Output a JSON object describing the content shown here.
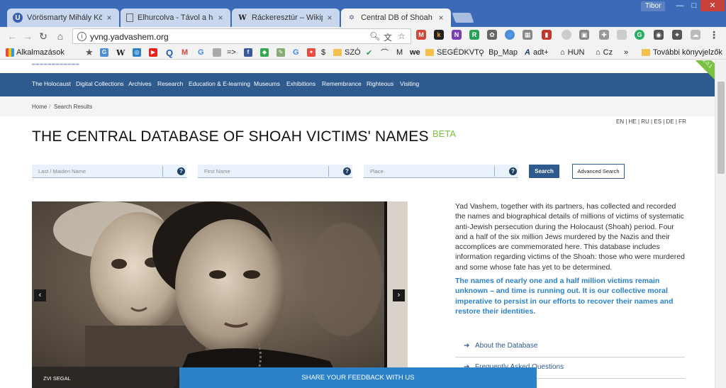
{
  "browser": {
    "tabs": [
      {
        "label": "Vörösmarty Mihály Köny",
        "icon": "library-icon"
      },
      {
        "label": "Elhurcolva - Távol a hazá",
        "icon": "page-icon"
      },
      {
        "label": "Ráckeresztúr – Wikipédia",
        "icon": "wikipedia-icon"
      },
      {
        "label": "Central DB of Shoah Victi",
        "icon": "yadvashem-icon"
      }
    ],
    "user": "Tibor",
    "url": "yvng.yadvashem.org",
    "bookmarks": {
      "apps": "Alkalmazások",
      "szo": "SZÓ",
      "m": "M",
      "segedkvt": "SEGÉDKVT",
      "bpmap": "Bp_Map",
      "adt": "adt+",
      "hun": "HUN",
      "cz": "Cz",
      "more": "»",
      "other": "További könyvjelzők",
      "arrow": "=>"
    }
  },
  "site": {
    "nav": [
      "The Holocaust",
      "Digital Collections",
      "Archives",
      "Research",
      "Education & E-learning",
      "Museums",
      "Exhibitions",
      "Remembrance",
      "Righteous",
      "Visiting"
    ],
    "version": "V.2.0.1",
    "breadcrumb": {
      "home": "Home",
      "sep": "/",
      "current": "Search Results"
    },
    "languages": "EN | HE | RU | ES | DE | FR",
    "title": "THE CENTRAL DATABASE OF SHOAH VICTIMS' NAMES",
    "beta": "BETA",
    "search": {
      "last_name_placeholder": "Last / Maiden Name",
      "first_name_placeholder": "First Name",
      "place_placeholder": "Place",
      "help": "?",
      "search_label": "Search",
      "advanced_label": "Advanced Search"
    },
    "photo": {
      "caption": "ZVI SEGAL",
      "prev": "‹",
      "next": "›"
    },
    "description": "Yad Vashem, together with its partners, has collected and recorded the names and biographical details of millions of victims of systematic anti-Jewish persecution during the Holocaust (Shoah) period. Four and a half of the six million Jews murdered by the Nazis and their accomplices are commemorated here. This database includes information regarding victims of the Shoah: those who were murdered and some whose fate has yet to be determined.",
    "emphasis": "The names of nearly one and a half million victims remain unknown – and time is running out. It is our collective moral imperative to persist in our efforts to recover their names and restore their identities.",
    "links": [
      "About the Database",
      "Frequently Asked Questions"
    ],
    "feedback": "SHARE YOUR FEEDBACK WITH US"
  }
}
